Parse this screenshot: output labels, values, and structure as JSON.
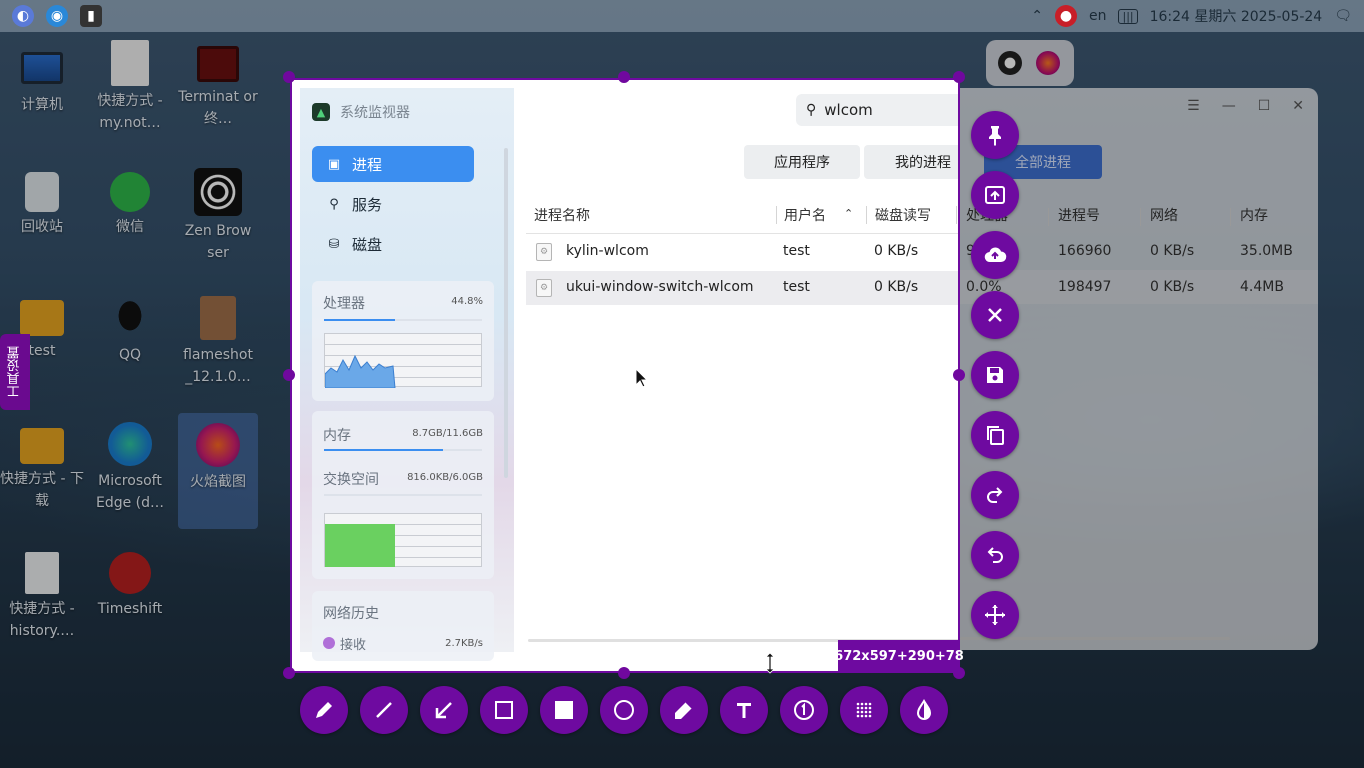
{
  "taskbar": {
    "lang": "en",
    "clock": "16:24 星期六 2025-05-24"
  },
  "desktop_icons": [
    {
      "label": "计算机"
    },
    {
      "label": "快捷方式 - my.not…"
    },
    {
      "label": "Terminat or 终…"
    },
    {
      "label": "回收站"
    },
    {
      "label": "微信"
    },
    {
      "label": "Zen Brow ser"
    },
    {
      "label": "test"
    },
    {
      "label": "QQ"
    },
    {
      "label": "flameshot _12.1.0…"
    },
    {
      "label": "快捷方式 - 下载"
    },
    {
      "label": "Microsoft Edge (d…"
    },
    {
      "label": "火焰截图"
    },
    {
      "label": "快捷方式 - history.…"
    },
    {
      "label": "Timeshift"
    }
  ],
  "side_tab": {
    "label": "工具设置"
  },
  "app": {
    "title": "系统监视器",
    "nav": [
      {
        "label": "进程",
        "icon": "process-icon",
        "active": true
      },
      {
        "label": "服务",
        "icon": "service-icon",
        "active": false
      },
      {
        "label": "磁盘",
        "icon": "disk-icon",
        "active": false
      }
    ],
    "cpu": {
      "label": "处理器",
      "value": "44.8%",
      "fraction": 0.448
    },
    "memory": {
      "label": "内存",
      "value": "8.7GB/11.6GB",
      "fraction": 0.75
    },
    "swap": {
      "label": "交换空间",
      "value": "816.0KB/6.0GB",
      "fraction": 0.0
    },
    "network": {
      "label": "网络历史",
      "recv_label": "接收",
      "recv_value": "2.7KB/s"
    },
    "search": {
      "value": "wlcom"
    },
    "tabs": [
      {
        "label": "应用程序",
        "active": false
      },
      {
        "label": "我的进程",
        "active": false
      },
      {
        "label": "全部进程",
        "active": true
      }
    ],
    "columns": [
      "进程名称",
      "用户名",
      "磁盘读写",
      "处理器",
      "进程号",
      "网络",
      "内存"
    ],
    "rows": [
      {
        "name": "kylin-wlcom",
        "user": "test",
        "disk": "0 KB/s",
        "cpu": "9",
        "pid": "166960",
        "net": "0 KB/s",
        "mem": "35.0MB"
      },
      {
        "name": "ukui-window-switch-wlcom",
        "user": "test",
        "disk": "0 KB/s",
        "cpu": "0.0%",
        "pid": "198497",
        "net": "0 KB/s",
        "mem": "4.4MB"
      }
    ]
  },
  "selection": {
    "size_label": "672x597+290+78"
  },
  "right_tools": [
    "pin-icon",
    "open-with-icon",
    "upload-icon",
    "close-icon",
    "save-icon",
    "copy-icon",
    "redo-icon",
    "undo-icon",
    "move-icon"
  ],
  "bottom_tools": [
    "pencil-icon",
    "line-icon",
    "arrow-icon",
    "rectangle-icon",
    "filled-rectangle-icon",
    "circle-icon",
    "marker-icon",
    "text-icon",
    "circle-counter-icon",
    "pixelate-icon",
    "invert-icon"
  ],
  "colors": {
    "accent": "#6e0aa0",
    "selected_nav": "#3b8ef0"
  }
}
